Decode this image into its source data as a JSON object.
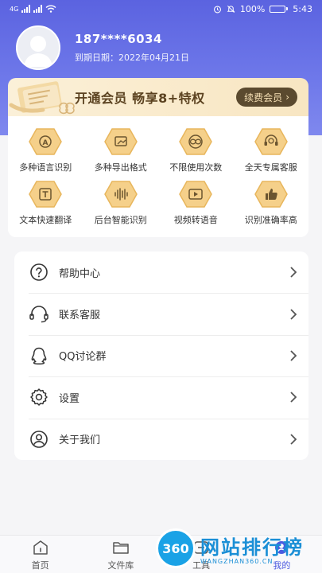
{
  "status_bar": {
    "network": "4G",
    "battery": "100%",
    "battery_level": 1.0,
    "time": "5:43"
  },
  "profile": {
    "phone": "187****6034",
    "expire_label": "到期日期：",
    "expire_date": "2022年04月21日"
  },
  "vip": {
    "title": "开通会员  畅享8+特权",
    "renew_label": "续费会员"
  },
  "benefits": [
    {
      "label": "多种语言识别",
      "icon": "language-a-icon"
    },
    {
      "label": "多种导出格式",
      "icon": "export-icon"
    },
    {
      "label": "不限使用次数",
      "icon": "infinity-icon"
    },
    {
      "label": "全天专属客服",
      "icon": "service-icon"
    },
    {
      "label": "文本快速翻译",
      "icon": "text-t-icon"
    },
    {
      "label": "后台智能识别",
      "icon": "waveform-icon"
    },
    {
      "label": "视频转语音",
      "icon": "video-play-icon"
    },
    {
      "label": "识别准确率高",
      "icon": "thumbs-up-icon"
    }
  ],
  "menu": [
    {
      "label": "帮助中心",
      "icon": "help-icon"
    },
    {
      "label": "联系客服",
      "icon": "headset-icon"
    },
    {
      "label": "QQ讨论群",
      "icon": "qq-icon"
    },
    {
      "label": "设置",
      "icon": "gear-icon"
    },
    {
      "label": "关于我们",
      "icon": "user-circle-icon"
    }
  ],
  "tabs": [
    {
      "label": "首页",
      "icon": "home-icon"
    },
    {
      "label": "文件库",
      "icon": "folder-icon"
    },
    {
      "label": "工具",
      "icon": "tools-icon"
    },
    {
      "label": "我的",
      "icon": "profile-icon"
    }
  ],
  "watermark": {
    "badge": "360",
    "cn": "网站排行榜",
    "en": "WANGZHAN360.CN"
  },
  "colors": {
    "header": "#5b63e0",
    "gold": "#f5c977",
    "accent": "#4c5be0"
  }
}
